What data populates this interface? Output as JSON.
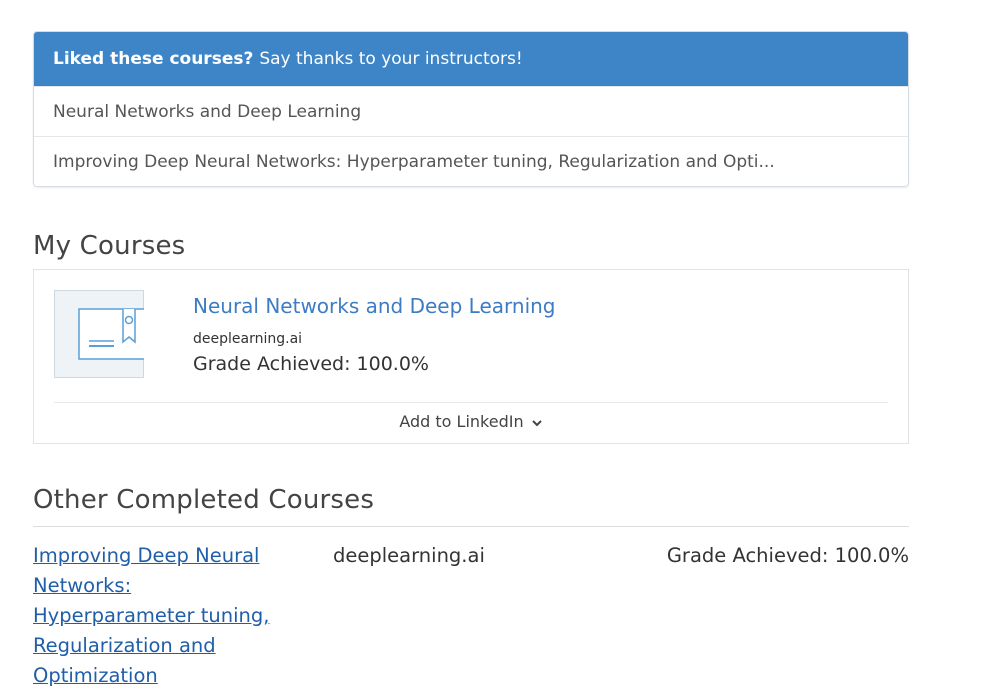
{
  "liked_panel": {
    "header_bold": "Liked these courses?",
    "header_text": "Say thanks to your instructors!",
    "items": [
      {
        "label": "Neural Networks and Deep Learning"
      },
      {
        "label": "Improving Deep Neural Networks: Hyperparameter tuning, Regularization and Opti..."
      }
    ]
  },
  "my_courses": {
    "title": "My Courses",
    "course": {
      "name": "Neural Networks and Deep Learning",
      "partner": "deeplearning.ai",
      "grade": "Grade Achieved: 100.0%",
      "thumbnail_icon": "certificate-icon"
    },
    "linkedin_label": "Add to LinkedIn",
    "linkedin_icon": "chevron-down-icon"
  },
  "other_completed": {
    "title": "Other Completed Courses",
    "rows": [
      {
        "name": "Improving Deep Neural Networks: Hyperparameter tuning, Regularization and Optimization",
        "partner": "deeplearning.ai",
        "grade": "Grade Achieved: 100.0%"
      }
    ]
  },
  "colors": {
    "header_bg": "#3d85c6",
    "link": "#3d7cc4",
    "other_link": "#1f5ea8"
  }
}
